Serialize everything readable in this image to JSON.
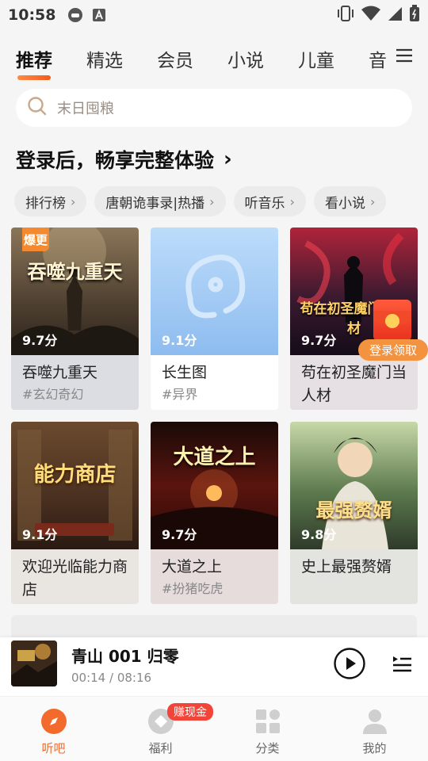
{
  "status_bar": {
    "time": "10:58"
  },
  "tabs": [
    {
      "label": "推荐",
      "active": true
    },
    {
      "label": "精选",
      "active": false
    },
    {
      "label": "会员",
      "active": false
    },
    {
      "label": "小说",
      "active": false
    },
    {
      "label": "儿童",
      "active": false
    },
    {
      "label": "音",
      "active": false
    }
  ],
  "search": {
    "placeholder": "末日囤粮"
  },
  "login_prompt": {
    "text": "登录后，畅享完整体验",
    "chevron": "›"
  },
  "chips": [
    {
      "label": "排行榜"
    },
    {
      "label": "唐朝诡事录|热播"
    },
    {
      "label": "听音乐"
    },
    {
      "label": "看小说"
    }
  ],
  "chip_chevron": "›",
  "books": [
    {
      "title": "吞噬九重天",
      "tag": "#玄幻奇幻",
      "score": "9.7分",
      "badge": "爆更",
      "cover_text": "吞噬九重天",
      "cover_color": "#6b5a44"
    },
    {
      "title": "长生图",
      "tag": "#异界",
      "score": "9.1分",
      "badge": "",
      "cover_text": "",
      "cover_color": "#a8cff5"
    },
    {
      "title": "苟在初圣魔门当人材",
      "tag": "",
      "score": "9.7分",
      "badge": "",
      "cover_text": "苟在初圣魔门当人材",
      "cover_color": "#2a1a2e"
    },
    {
      "title": "欢迎光临能力商店",
      "tag": "",
      "score": "9.1分",
      "badge": "",
      "cover_text": "能力商店",
      "cover_color": "#5a3a22"
    },
    {
      "title": "大道之上",
      "tag": "#扮猪吃虎",
      "score": "9.7分",
      "badge": "",
      "cover_text": "大道之上",
      "cover_color": "#3a0d0a"
    },
    {
      "title": "史上最强赘婿",
      "tag": "",
      "score": "9.8分",
      "badge": "",
      "cover_text": "最强赘婿",
      "cover_color": "#3a5a4a"
    }
  ],
  "red_packet": {
    "label": "登录领取"
  },
  "player": {
    "title": "青山 001 归零",
    "time": "00:14 / 08:16"
  },
  "bottom_nav": [
    {
      "label": "听吧",
      "active": true,
      "icon": "compass-icon"
    },
    {
      "label": "福利",
      "active": false,
      "icon": "welfare-icon",
      "badge": "赚现金"
    },
    {
      "label": "分类",
      "active": false,
      "icon": "category-icon"
    },
    {
      "label": "我的",
      "active": false,
      "icon": "profile-icon"
    }
  ],
  "colors": {
    "accent": "#f26a2c",
    "badge_red": "#f2453a",
    "chip_bg": "#ebebeb"
  }
}
